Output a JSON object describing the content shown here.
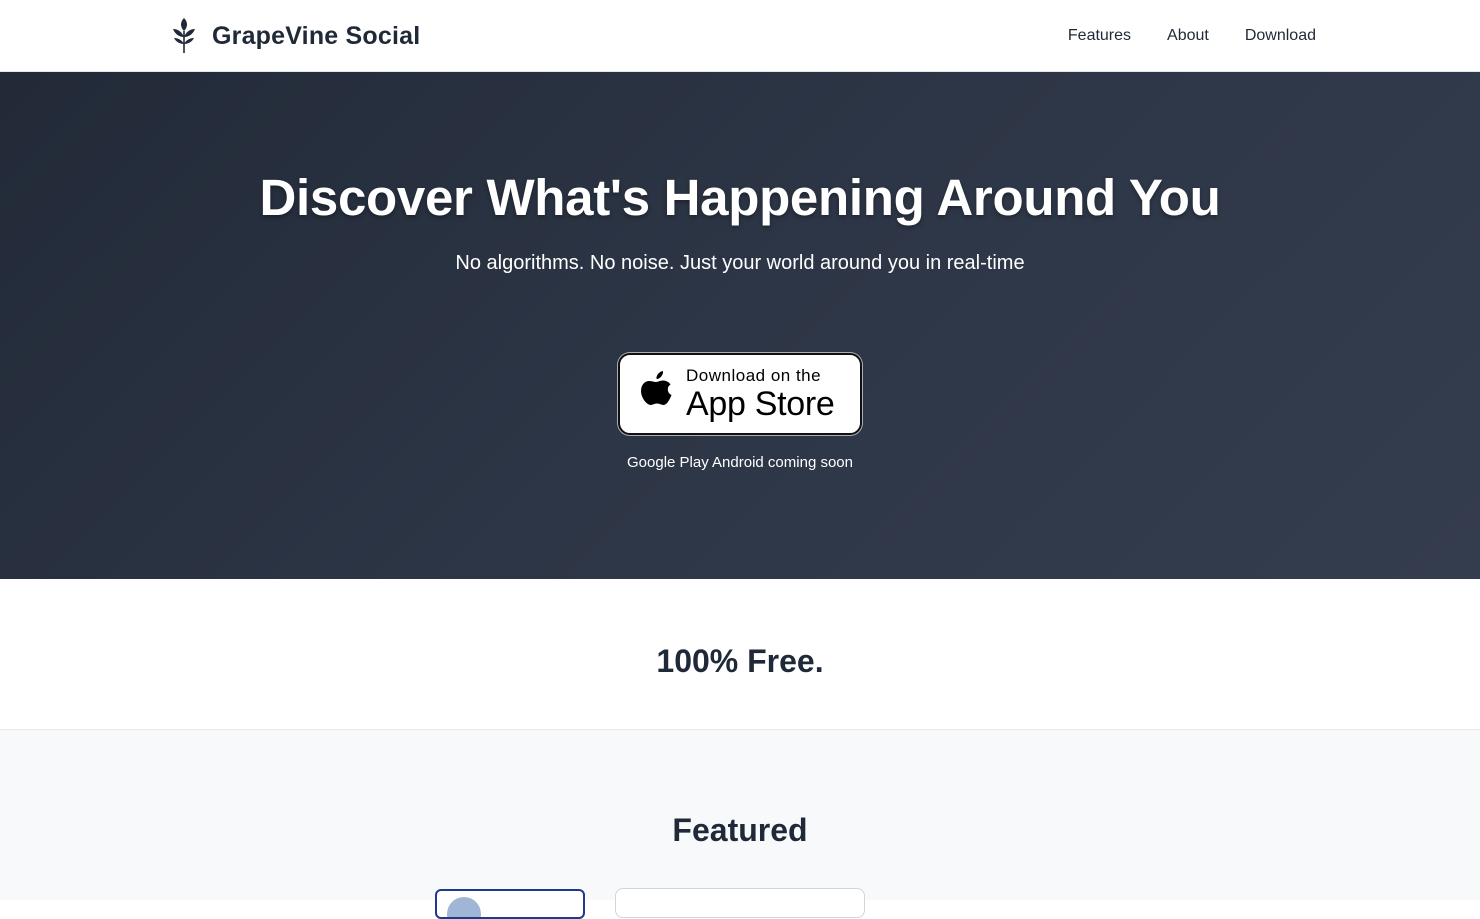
{
  "header": {
    "brand_name": "GrapeVine Social",
    "brand_icon": "leaf-sprig-icon",
    "nav": [
      {
        "label": "Features"
      },
      {
        "label": "About"
      },
      {
        "label": "Download"
      }
    ]
  },
  "hero": {
    "title": "Discover What's Happening Around You",
    "subtitle": "No algorithms. No noise. Just your world around you in real-time",
    "app_store": {
      "small_label": "Download on the",
      "big_label": "App Store",
      "icon": "apple-icon"
    },
    "coming_soon": "Google Play Android coming soon"
  },
  "free": {
    "title": "100% Free."
  },
  "featured": {
    "title": "Featured"
  },
  "colors": {
    "hero_bg_start": "#222a38",
    "hero_bg_end": "#343d4e",
    "text_dark": "#1f2937",
    "featured_bg": "#f8f9fb",
    "card_border_accent": "#1e3a8a"
  }
}
